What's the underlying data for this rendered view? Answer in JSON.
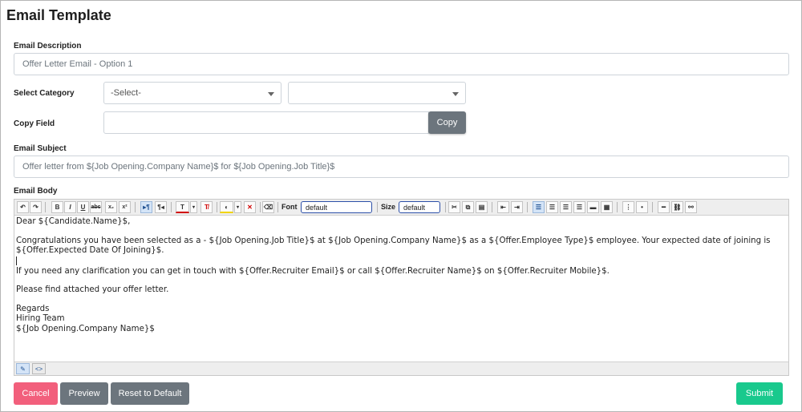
{
  "page": {
    "title": "Email Template"
  },
  "form": {
    "description": {
      "label": "Email Description",
      "value": "Offer Letter Email - Option 1"
    },
    "category": {
      "label": "Select Category",
      "value": "-Select-",
      "sub_value": ""
    },
    "copy_field": {
      "label": "Copy Field",
      "value": "",
      "button": "Copy"
    },
    "subject": {
      "label": "Email Subject",
      "value": "Offer letter from ${Job Opening.Company Name}$ for ${Job Opening.Job Title}$"
    },
    "body": {
      "label": "Email Body"
    }
  },
  "toolbar": {
    "font_label": "Font",
    "font_value": "default",
    "size_label": "Size",
    "size_value": "default"
  },
  "editor": {
    "lines": [
      "Dear ${Candidate.Name}$,",
      "",
      "Congratulations you have been selected as a - ${Job Opening.Job Title}$ at ${Job Opening.Company Name}$ as a ${Offer.Employee Type}$ employee. Your expected date of joining is",
      "${Offer.Expected Date Of Joining}$.",
      "",
      "If you need any clarification you can get in touch with ${Offer.Recruiter Email}$ or call ${Offer.Recruiter Name}$ on ${Offer.Recruiter Mobile}$.",
      "",
      "Please find attached your offer letter.",
      "",
      "Regards",
      "Hiring Team",
      "${Job Opening.Company Name}$"
    ]
  },
  "buttons": {
    "cancel": "Cancel",
    "preview": "Preview",
    "reset": "Reset to Default",
    "submit": "Submit"
  },
  "colors": {
    "cancel": "#f25f7c",
    "secondary": "#6c757d",
    "submit": "#19c98d",
    "accent": "#2c4fa8"
  }
}
